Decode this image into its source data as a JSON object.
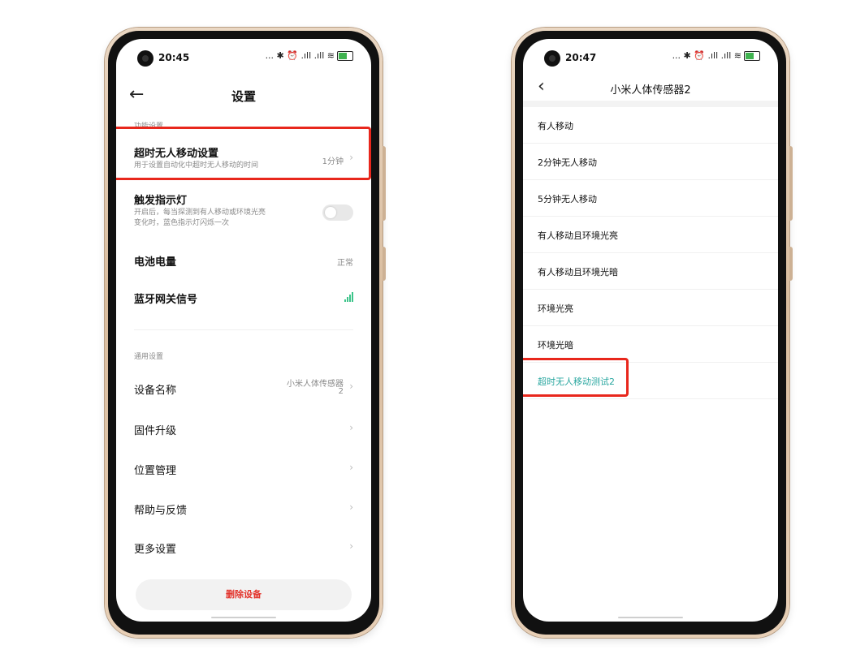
{
  "colors": {
    "accent_teal": "#2aa7a0",
    "delete_red": "#e3352d",
    "highlight_red": "#e8271c",
    "signal_green": "#3cc48a",
    "frame_gold": "#d9bd9f"
  },
  "left_phone": {
    "status": {
      "time": "20:45",
      "icons": "... ✱ ⏰ .ıll .ıll ≋"
    },
    "header": {
      "back_icon": "arrow-left-icon",
      "title": "设置"
    },
    "function_section": {
      "label": "功能设置",
      "timeout": {
        "title": "超时无人移动设置",
        "subtitle": "用于设置自动化中超时无人移动的时间",
        "value": "1分钟",
        "chevron": "›"
      },
      "indicator": {
        "title": "触发指示灯",
        "subtitle_line1": "开启后，每当探测到有人移动或环境光亮",
        "subtitle_line2": "变化时，蓝色指示灯闪烁一次",
        "toggle_on": false
      },
      "battery": {
        "title": "电池电量",
        "value": "正常"
      },
      "bluetooth": {
        "title": "蓝牙网关信号",
        "signal_level": 4
      }
    },
    "general_section": {
      "label": "通用设置",
      "items": [
        {
          "title": "设备名称",
          "value_line1": "小米人体传感器",
          "value_line2": "2",
          "chevron": "›"
        },
        {
          "title": "固件升级",
          "chevron": "›"
        },
        {
          "title": "位置管理",
          "chevron": "›"
        },
        {
          "title": "帮助与反馈",
          "chevron": "›"
        },
        {
          "title": "更多设置",
          "chevron": "›"
        }
      ]
    },
    "delete_button": "删除设备"
  },
  "right_phone": {
    "status": {
      "time": "20:47",
      "icons": "... ✱ ⏰ .ıll .ıll ≋"
    },
    "header": {
      "back_icon": "chevron-left-icon",
      "back_glyph": "‹",
      "title": "小米人体传感器2"
    },
    "items": [
      {
        "label": "有人移动",
        "active": false
      },
      {
        "label": "2分钟无人移动",
        "active": false
      },
      {
        "label": "5分钟无人移动",
        "active": false
      },
      {
        "label": "有人移动且环境光亮",
        "active": false
      },
      {
        "label": "有人移动且环境光暗",
        "active": false
      },
      {
        "label": "环境光亮",
        "active": false
      },
      {
        "label": "环境光暗",
        "active": false
      },
      {
        "label": "超时无人移动测试2",
        "active": true
      }
    ]
  }
}
